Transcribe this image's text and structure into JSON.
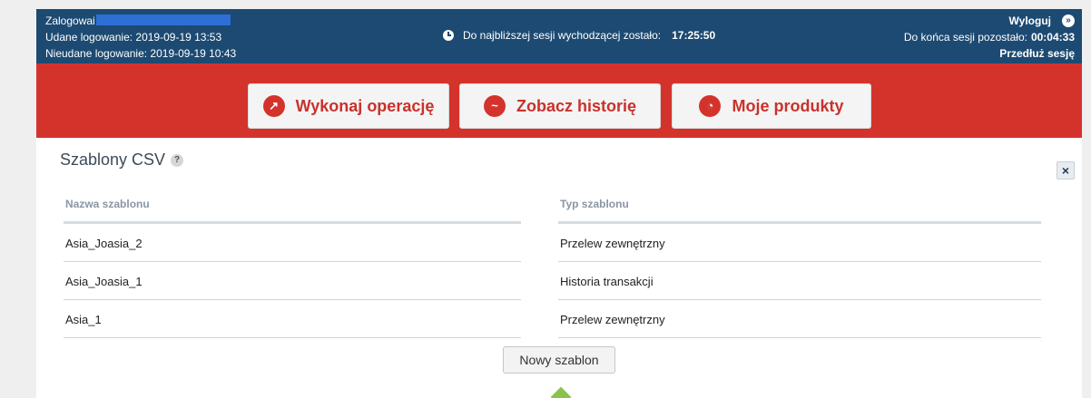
{
  "session": {
    "logged_label": "Zalogowai",
    "last_success": "Udane logowanie: 2019-09-19 13:53",
    "last_failed": "Nieudane logowanie: 2019-09-19 10:43",
    "outgoing_label": "Do najbliższej sesji wychodzącej zostało:",
    "outgoing_time": "17:25:50",
    "logout": "Wyloguj",
    "session_left_label": "Do końca sesji pozostało:",
    "session_left_time": "00:04:33",
    "extend": "Przedłuż sesję"
  },
  "nav": {
    "operation": "Wykonaj operację",
    "history": "Zobacz historię",
    "products": "Moje produkty"
  },
  "panel": {
    "title": "Szablony CSV",
    "help_glyph": "?",
    "close_glyph": "×",
    "columns": [
      "Nazwa szablonu",
      "Typ szablonu"
    ],
    "rows": [
      [
        "Asia_Joasia_2",
        "Przelew zewnętrzny"
      ],
      [
        "Asia_Joasia_1",
        "Historia transakcji"
      ],
      [
        "Asia_1",
        "Przelew zewnętrzny"
      ]
    ],
    "new_button": "Nowy szablon"
  },
  "colors": {
    "topbar": "#1d4a72",
    "navbar": "#d4332c",
    "accent": "#c8322c"
  },
  "icons": [
    "clock-icon",
    "logout-icon",
    "edit-icon",
    "chart-icon",
    "pie-icon",
    "help-icon",
    "close-icon"
  ]
}
